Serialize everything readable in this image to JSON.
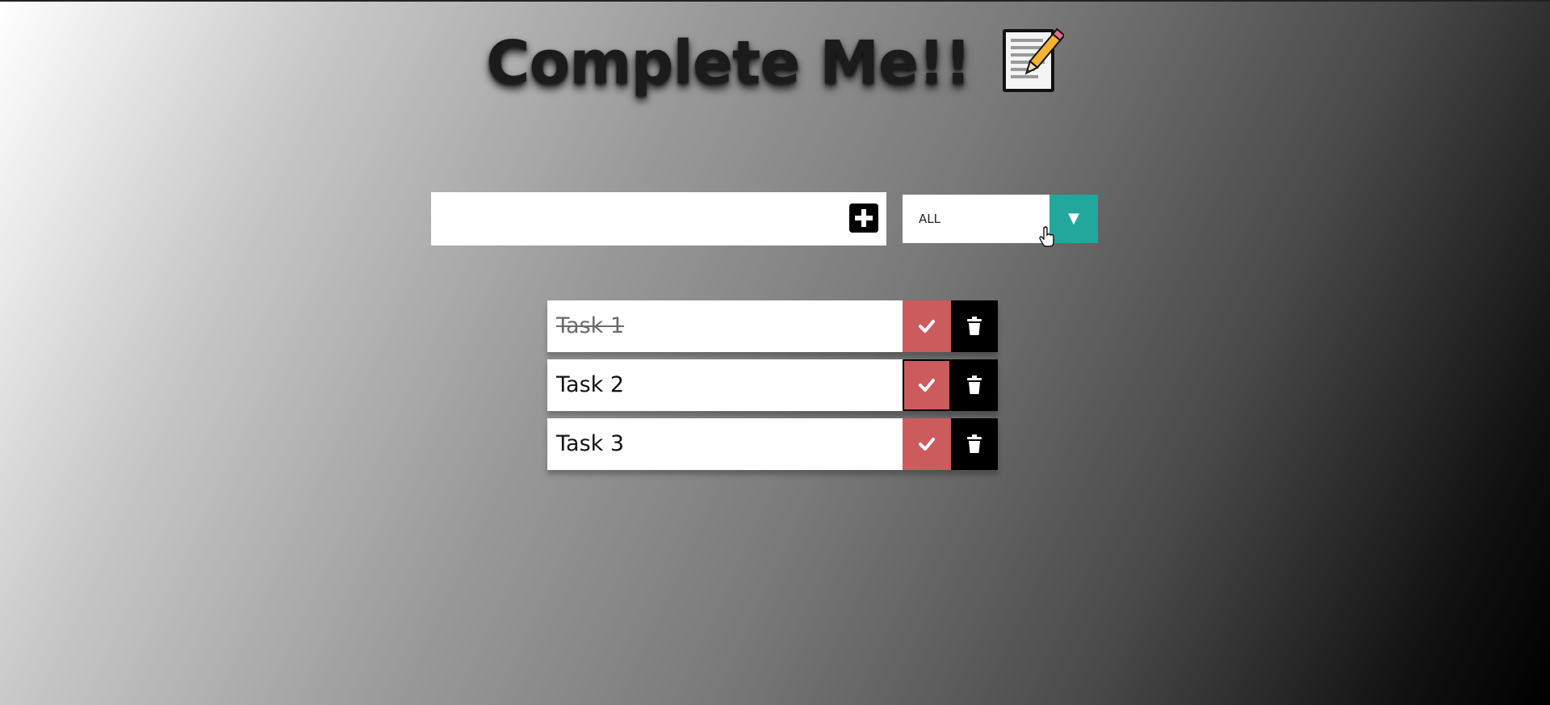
{
  "header": {
    "title": "Complete Me!!",
    "title_icon": "memo-icon"
  },
  "form": {
    "input_value": "",
    "add_icon": "plus-square-icon",
    "filter": {
      "selected": "ALL",
      "arrow": "▼",
      "accent_color": "#23a79d"
    }
  },
  "todos": [
    {
      "text": "Task 1",
      "completed": true
    },
    {
      "text": "Task 2",
      "completed": false
    },
    {
      "text": "Task 3",
      "completed": false
    }
  ],
  "colors": {
    "complete_button": "#cc5b5d",
    "trash_button": "#000000"
  }
}
